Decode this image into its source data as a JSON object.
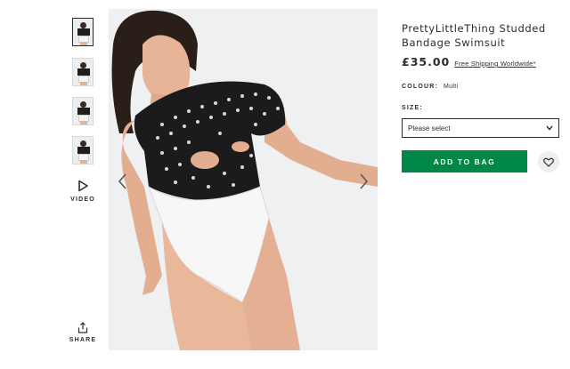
{
  "thumbnails": [
    "thumbnail-front",
    "thumbnail-side",
    "thumbnail-back",
    "thumbnail-full"
  ],
  "media": {
    "video_label": "VIDEO",
    "share_label": "SHARE"
  },
  "product": {
    "title": "PrettyLittleThing Studded Bandage Swimsuit",
    "price": "£35.00",
    "shipping": "Free Shipping Worldwide*",
    "colour_label": "COLOUR:",
    "colour_value": "Multi",
    "size_label": "SIZE:",
    "size_placeholder": "Please select",
    "add_to_bag": "ADD TO BAG"
  },
  "colors": {
    "accent": "#018849",
    "text": "#2d2d2d",
    "image_bg": "#eff0f1"
  },
  "icons": [
    "play-icon",
    "share-icon",
    "chevron-left-icon",
    "chevron-right-icon",
    "chevron-down-icon",
    "heart-icon"
  ]
}
